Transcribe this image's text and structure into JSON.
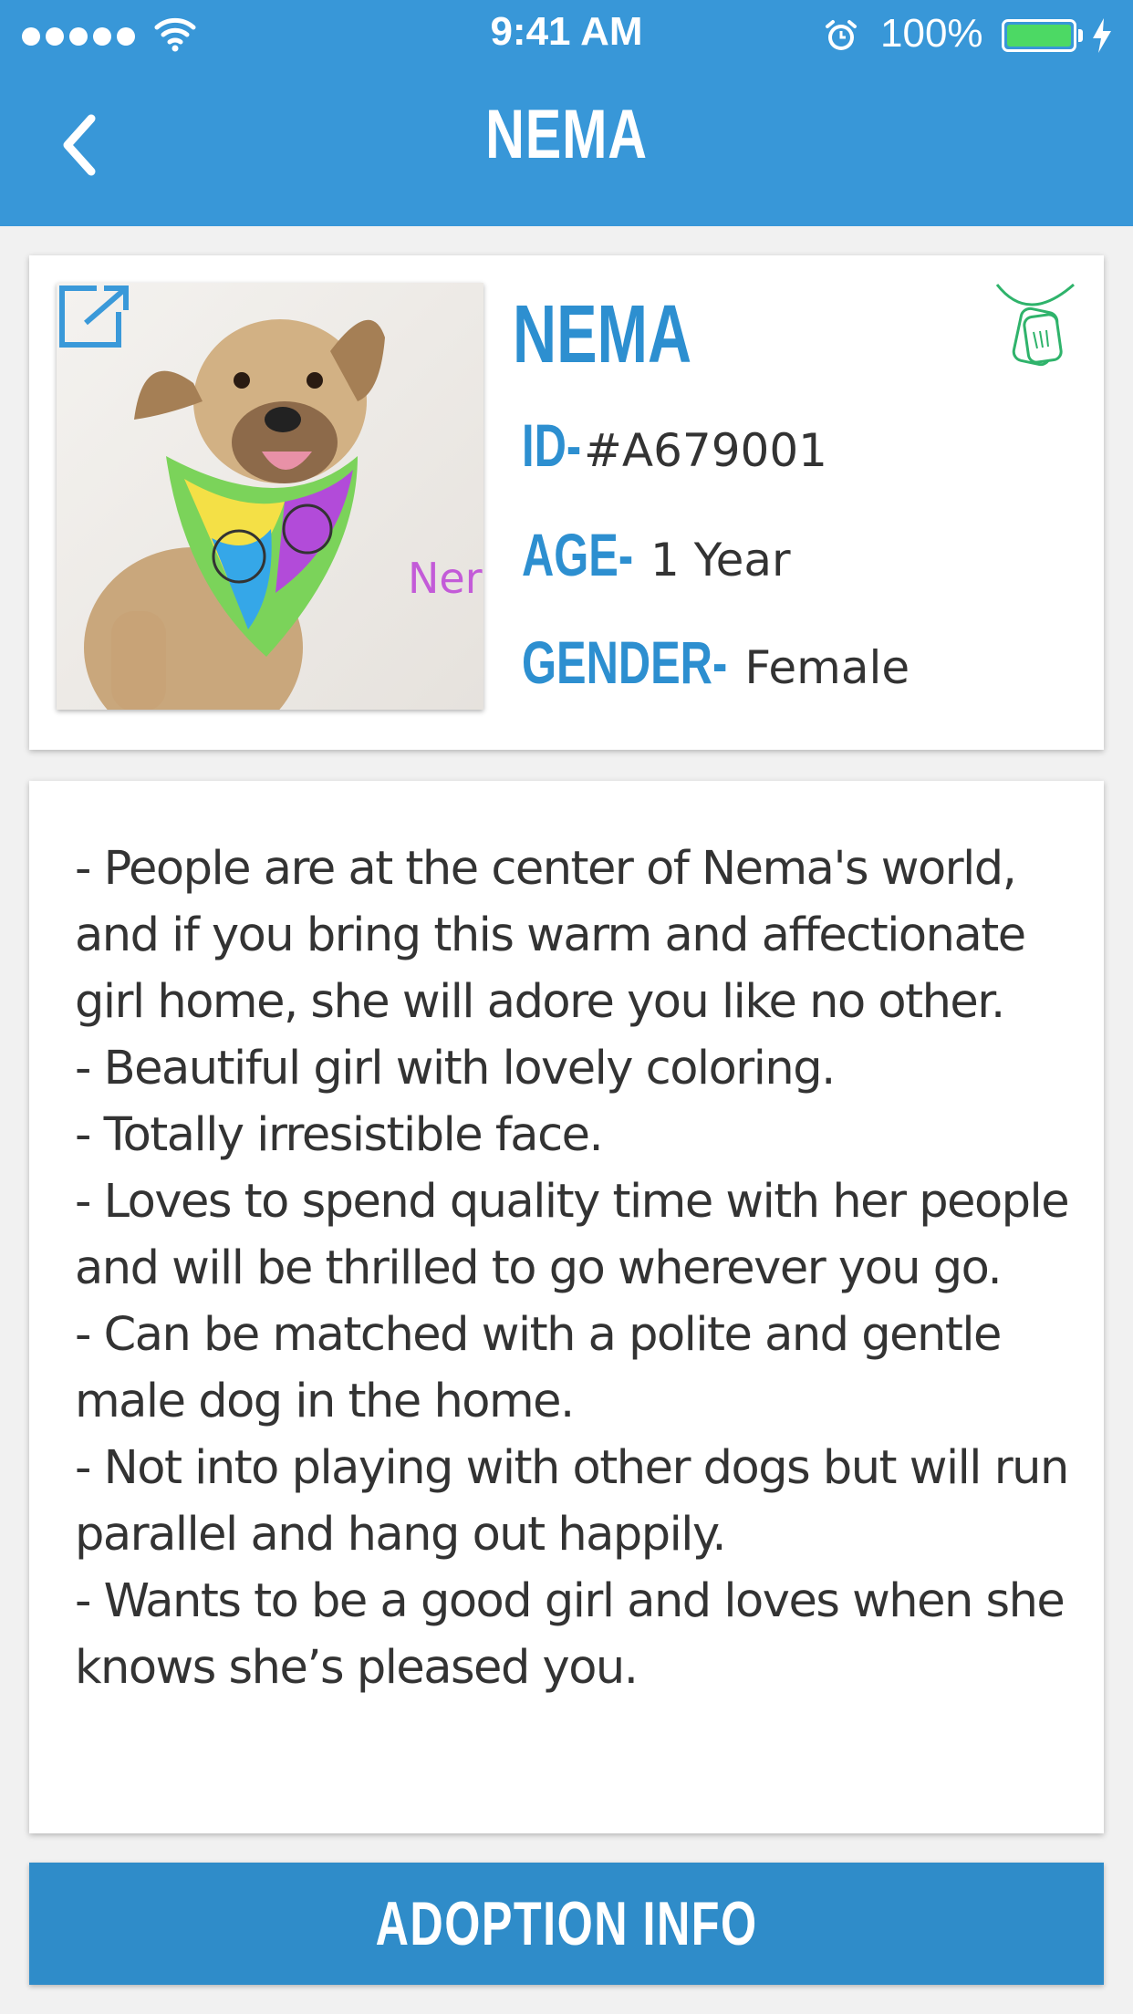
{
  "status_bar": {
    "time": "9:41 AM",
    "battery": "100%",
    "signal_icon": "signal-dots-icon",
    "wifi_icon": "wifi-icon",
    "alarm_icon": "alarm-clock-icon",
    "charging_icon": "bolt-icon"
  },
  "header": {
    "title": "NEMA",
    "back_icon": "chevron-left-icon",
    "color": "#3897d8"
  },
  "pet": {
    "name": "NEMA",
    "photo_caption": "Ner",
    "id_label": "ID-",
    "id_value": "#A679001",
    "age_label": "AGE-",
    "age_value": "1 Year",
    "gender_label": "GENDER-",
    "gender_value": "Female",
    "accent_color": "#2d8fd0",
    "tag_icon_color": "#2fb36b"
  },
  "description": [
    "- People are at the center of Nema's world, and if you bring this warm and affectionate girl home, she will adore you like no other.",
    "- Beautiful girl with lovely coloring.",
    "- Totally irresistible face.",
    "- Loves to spend quality time with her people and will be thrilled to go wherever you go.",
    "- Can be matched with a polite and gentle male dog in the home.",
    "- Not into playing with other dogs but will run parallel and hang out happily.",
    "- Wants to be a good girl and loves when she knows she’s pleased you."
  ],
  "footer": {
    "button_label": "ADOPTION INFO",
    "button_color": "#2f8cc9"
  }
}
